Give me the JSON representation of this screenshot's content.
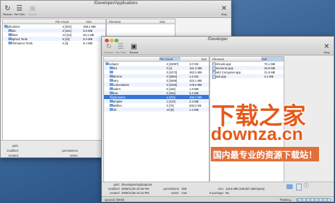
{
  "back_window": {
    "title": "/Developer/Applications",
    "toolbar": {
      "rescan": "Rescan",
      "set_path": "Set Path",
      "reveal": "Reveal",
      "stop": "Stop"
    },
    "tree_columns": {
      "name": "",
      "file_count": "File Count",
      "size": "Size"
    },
    "tree_rows": [
      {
        "name": "Applications",
        "count": "4 [202]",
        "size": "286.2 MB"
      },
      {
        "name": "Audio",
        "count": "2 [161]",
        "size": "9.6 MB"
      },
      {
        "name": "Utilities",
        "count": "13 [10]",
        "size": "93.1 MB"
      },
      {
        "name": "Graphics Tools",
        "count": "6 [23]",
        "size": "5.0 MB"
      },
      {
        "name": "Performance Tools",
        "count": "4 [4]",
        "size": "8.4 MB"
      }
    ],
    "file_columns": {
      "filename": "Filename",
      "size": "Size"
    },
    "info": {
      "path": "path:",
      "modified": "modified:",
      "created": "created:",
      "permissions": "permissions:",
      "owner": "owner:"
    }
  },
  "front_window": {
    "title": "/Developer",
    "toolbar": {
      "rescan": "Rescan",
      "set_path": "Set Path",
      "reveal": "Reveal",
      "stop": "Stop"
    },
    "tree_columns": {
      "name": "",
      "file_count": "File Count",
      "size": "Size"
    },
    "tree_rows": [
      {
        "name": "Developer",
        "count": "2 [19087]",
        "size": "3.0 GB",
        "sel": false
      },
      {
        "name": "SDKs",
        "count": "0 [1]",
        "size": "161.3 MB",
        "sel": false
      },
      {
        "name": "usr",
        "count": "0 [4273]",
        "size": "463.3 MB",
        "sel": false
      },
      {
        "name": "Platforms",
        "count": "0 [3964]",
        "size": "1.6 GB",
        "sel": false
      },
      {
        "name": "Library",
        "count": "0 [3559]",
        "size": "423.1 MB",
        "sel": false
      },
      {
        "name": "Documentation",
        "count": "3 [1626]",
        "size": "178.0 MB",
        "sel": false
      },
      {
        "name": "Headers",
        "count": "0 [446]",
        "size": "1.8 MB",
        "sel": false
      },
      {
        "name": "Extras",
        "count": "0 [265]",
        "size": "6.3 MB",
        "sel": false
      },
      {
        "name": "Applications",
        "count": "4 [202]",
        "size": "286.2 MB",
        "sel": true
      },
      {
        "name": "Examples",
        "count": "1 [120]",
        "size": "2.4 MB",
        "sel": false
      },
      {
        "name": "Makefiles",
        "count": "0 [70]",
        "size": "832.0 KB",
        "sel": false
      },
      {
        "name": "Tools",
        "count": "19 [0]",
        "size": "1.2 MB",
        "sel": false
      }
    ],
    "file_columns": {
      "filename": "Filename",
      "size": "Size"
    },
    "files": [
      {
        "name": "Dashcode.app",
        "size": "76.1 MB"
      },
      {
        "name": "Instruments.app",
        "size": "25.8 MB"
      },
      {
        "name": "Quartz Composer.app",
        "size": "21.9 MB"
      },
      {
        "name": "Xcode.app",
        "size": "3.2 MB"
      }
    ],
    "info": {
      "path_label": "path:",
      "path_value": "/Developer/Applications",
      "modified_label": "modified:",
      "modified_value": "2009/11/30 10:46 PM",
      "created_label": "created:",
      "created_value": "2009/11/30 10:41 PM",
      "permissions_label": "permissions:",
      "permissions_value": "505",
      "owner_label": "owner:",
      "owner_value": "root",
      "size_label": "size:",
      "size_value": "133.5 MB (139,837,488 bytes)",
      "package_label": "is package:",
      "package_value": "No"
    },
    "status": {
      "left": "Ignored: [0000]",
      "right": "Thinking..."
    }
  },
  "watermark": {
    "title": "下载之家",
    "domain": "downza.cn",
    "slogan": "国内最专业的资源下载站！"
  },
  "colors": {
    "selection": "#3875d7",
    "close": "#e2463f",
    "minimize": "#f2b43a",
    "zoom": "#57b947",
    "watermark": "#e55a1c"
  }
}
